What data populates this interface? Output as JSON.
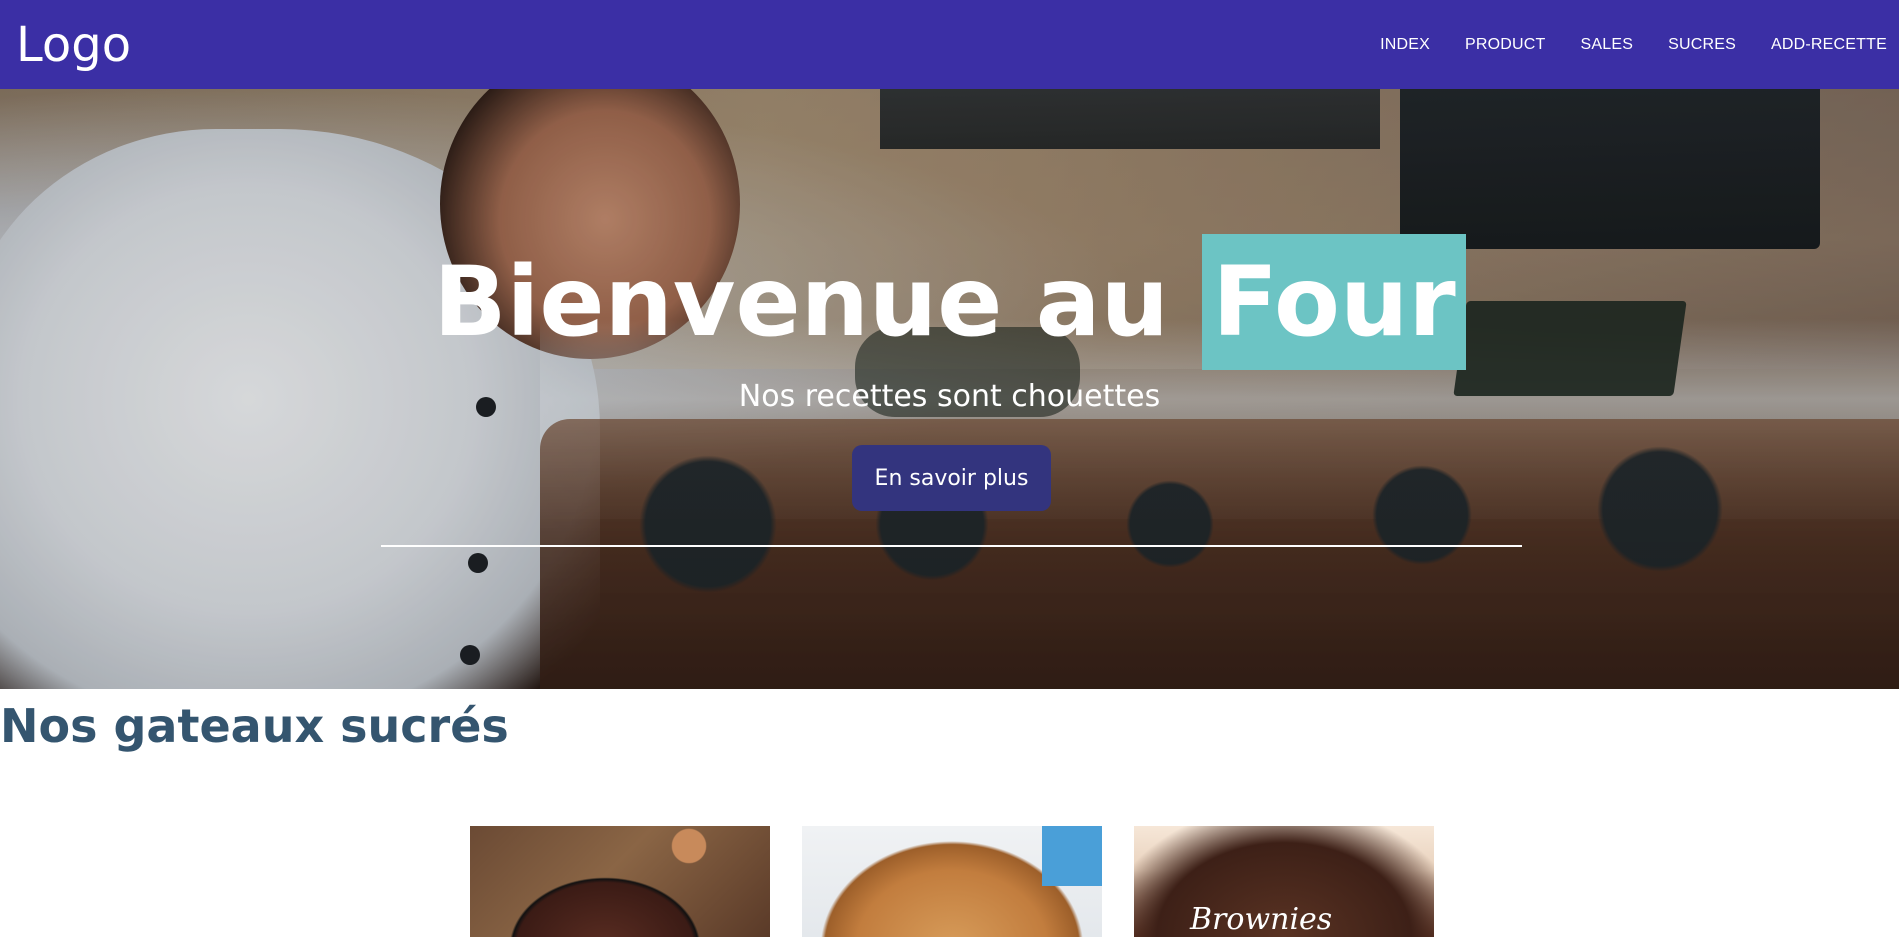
{
  "header": {
    "logo": "Logo",
    "nav": [
      {
        "label": "INDEX"
      },
      {
        "label": "PRODUCT"
      },
      {
        "label": "SALES"
      },
      {
        "label": "SUCRES"
      },
      {
        "label": "ADD-RECETTE"
      }
    ]
  },
  "hero": {
    "title_prefix": "Bienvenue au ",
    "title_highlight": "Four",
    "subtitle": "Nos recettes sont chouettes",
    "cta_label": "En savoir plus"
  },
  "section": {
    "title": "Nos gateaux sucrés",
    "cards": [
      {
        "image_text": ""
      },
      {
        "image_text": ""
      },
      {
        "image_text": "Brownies"
      }
    ]
  },
  "colors": {
    "navbar_bg": "#3b2fa5",
    "highlight_bg": "#6cc4c4",
    "cta_bg": "#33347e",
    "section_title": "#34556f"
  }
}
